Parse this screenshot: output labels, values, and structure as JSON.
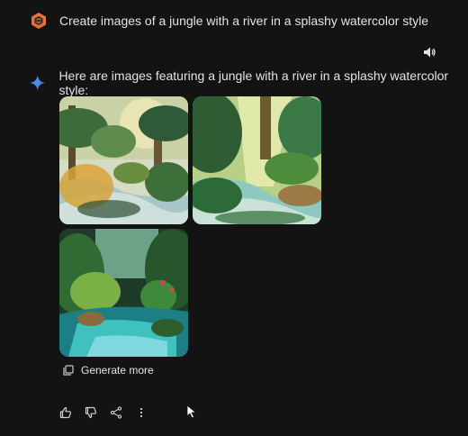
{
  "user_prompt": {
    "text": "Create images of a jungle with a river in a splashy watercolor style",
    "avatar_icon": "hexagon-logo-icon"
  },
  "toolbar": {
    "speaker_icon": "speaker-icon"
  },
  "response": {
    "icon": "sparkle-icon",
    "text": "Here are images featuring a jungle with a river in a splashy watercolor style:",
    "images": [
      {
        "name": "jungle-image-1"
      },
      {
        "name": "jungle-image-2"
      },
      {
        "name": "jungle-image-3"
      }
    ],
    "generate_more_label": "Generate more"
  },
  "actions": [
    "thumbs-up-icon",
    "thumbs-down-icon",
    "share-icon",
    "more-vert-icon"
  ],
  "colors": {
    "background": "#131314",
    "text": "#e3e3e3",
    "accent_orange": "#e8713a",
    "sparkle_blue": "#4b8df8"
  }
}
